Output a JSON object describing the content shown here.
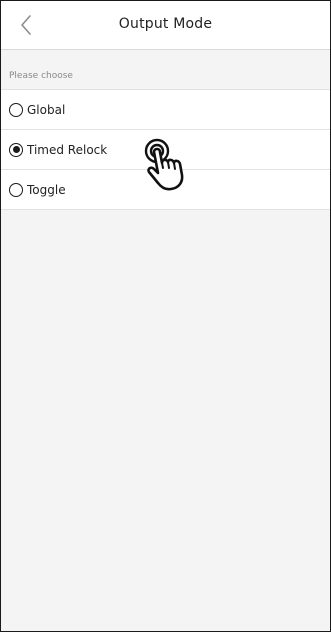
{
  "header": {
    "title": "Output Mode",
    "back_icon": "chevron-left-icon"
  },
  "section": {
    "label": "Please choose"
  },
  "options": [
    {
      "label": "Global",
      "selected": false
    },
    {
      "label": "Timed Relock",
      "selected": true
    },
    {
      "label": "Toggle",
      "selected": false
    }
  ],
  "overlay": {
    "icon": "tap-hand-icon"
  }
}
